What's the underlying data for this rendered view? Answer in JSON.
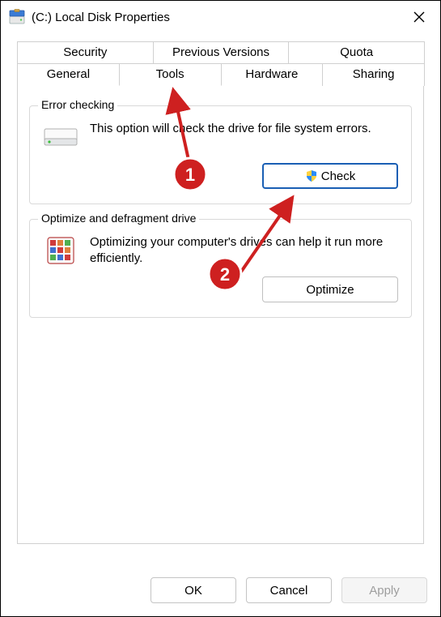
{
  "window": {
    "title": "(C:) Local Disk Properties"
  },
  "tabs": {
    "row1": [
      "Security",
      "Previous Versions",
      "Quota"
    ],
    "row2": [
      "General",
      "Tools",
      "Hardware",
      "Sharing"
    ],
    "active": "Tools"
  },
  "errorchecking": {
    "legend": "Error checking",
    "text": "This option will check the drive for file system errors.",
    "button": "Check"
  },
  "optimize": {
    "legend": "Optimize and defragment drive",
    "text": "Optimizing your computer's drives can help it run more efficiently.",
    "button": "Optimize"
  },
  "footer": {
    "ok": "OK",
    "cancel": "Cancel",
    "apply": "Apply"
  },
  "annotations": {
    "step1": "1",
    "step2": "2"
  }
}
